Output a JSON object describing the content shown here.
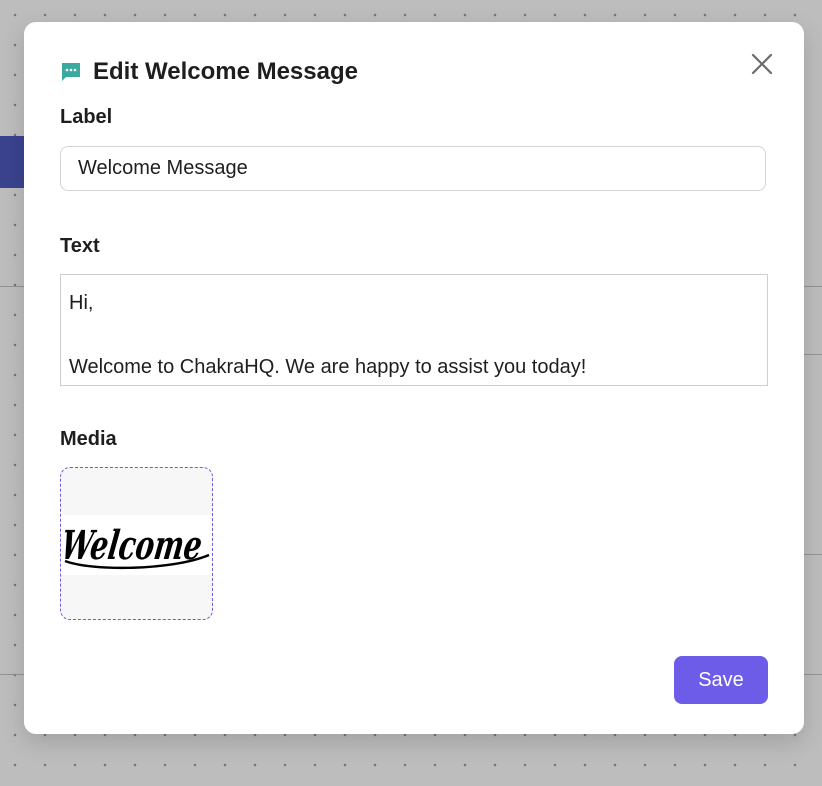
{
  "modal": {
    "title": "Edit Welcome Message",
    "icon": "message-icon",
    "accent_color": "#3aa99f"
  },
  "form": {
    "label_heading": "Label",
    "label_value": "Welcome Message",
    "text_heading": "Text",
    "text_value": "Hi,\n\nWelcome to ChakraHQ. We are happy to assist you today!",
    "media_heading": "Media",
    "media_image_text": "Welcome"
  },
  "actions": {
    "save_label": "Save",
    "save_color": "#6c5ce7"
  }
}
